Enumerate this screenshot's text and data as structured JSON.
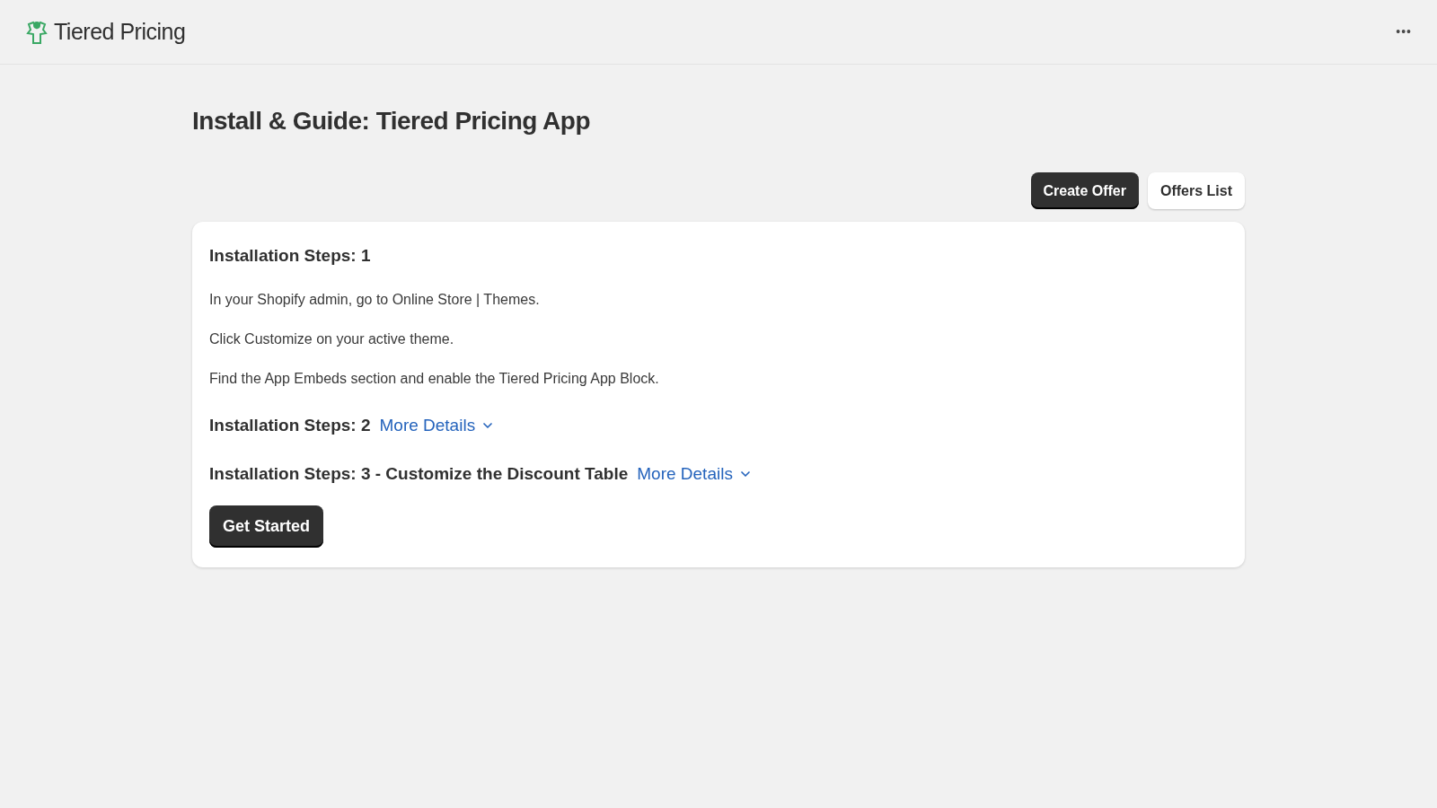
{
  "app_bar": {
    "title": "Tiered Pricing",
    "menu": "•••"
  },
  "page": {
    "title": "Install & Guide: Tiered Pricing App"
  },
  "actions": [
    {
      "label": "Create Offer",
      "kind": "primary"
    },
    {
      "label": "Offers List",
      "kind": "secondary"
    }
  ],
  "steps": [
    {
      "title": "Installation Steps: 1",
      "expanded": true,
      "paragraphs": [
        "In your Shopify admin, go to Online Store | Themes.",
        "Click Customize on your active theme.",
        "Find the App Embeds section and enable the Tiered Pricing App Block."
      ]
    },
    {
      "title": "Installation Steps: 2",
      "expanded": false,
      "toggle_label": "More Details"
    },
    {
      "title": "Installation Steps: 3 - Customize the Discount Table",
      "expanded": false,
      "toggle_label": "More Details"
    }
  ],
  "get_started": {
    "label": "Get Started"
  }
}
